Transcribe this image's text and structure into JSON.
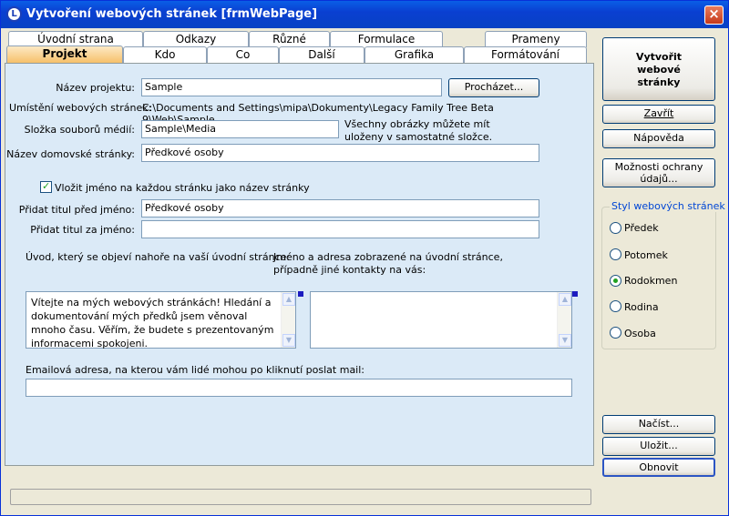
{
  "window": {
    "title": "Vytvoření webových stránek [frmWebPage]",
    "logo_letter": "L",
    "close": "×"
  },
  "tabs": {
    "row1": [
      "Úvodní strana",
      "Odkazy",
      "Různé",
      "Formulace",
      "Prameny"
    ],
    "row2": [
      "Projekt",
      "Kdo",
      "Co",
      "Další",
      "Grafika",
      "Formátování"
    ]
  },
  "form": {
    "project_name_label": "Název projektu:",
    "project_name_value": "Sample",
    "browse_button": "Procházet...",
    "location_label": "Umístění webových stránek:",
    "location_value": "C:\\Documents and Settings\\mipa\\Dokumenty\\Legacy Family Tree Beta",
    "location_value_line2": "9\\Web\\Sample",
    "media_folder_label": "Složka souborů médií:",
    "media_folder_value": "Sample\\Media",
    "media_note": "Všechny obrázky můžete mít uloženy v samostatné složce.",
    "home_page_label": "Název domovské stránky:",
    "home_page_value": "Předkové osoby",
    "insert_name_checkbox": "Vložit jméno na každou stránku jako název stránky",
    "insert_name_checked": true,
    "title_before_label": "Přidat titul před jméno:",
    "title_before_value": "Předkové osoby",
    "title_after_label": "Přidat titul za jméno:",
    "title_after_value": "",
    "intro_label": "Úvod, který se objeví nahoře na vaší úvodní stránce:",
    "intro_text": "Vítejte na mých webových stránkách!  Hledání a dokumentování mých předků jsem věnoval mnoho času. Věřím, že budete s prezentovaným informacemi spokojeni.",
    "contact_label": "Jméno a adresa zobrazené na úvodní stránce, případně jiné kontakty na vás:",
    "contact_text": "",
    "email_label": "Emailová adresa, na kterou vám lidé mohou po kliknutí poslat mail:",
    "email_value": ""
  },
  "side": {
    "create_button": "Vytvořit webové stránky",
    "close_button": "Zavřít",
    "help_button": "Nápověda",
    "privacy_button": "Možnosti ochrany údajů...",
    "style_group_title": "Styl webových stránek",
    "styles": [
      "Předek",
      "Potomek",
      "Rodokmen",
      "Rodina",
      "Osoba"
    ],
    "selected_style": "Rodokmen",
    "load_button": "Načíst...",
    "save_button": "Uložit...",
    "refresh_button": "Obnovit"
  }
}
